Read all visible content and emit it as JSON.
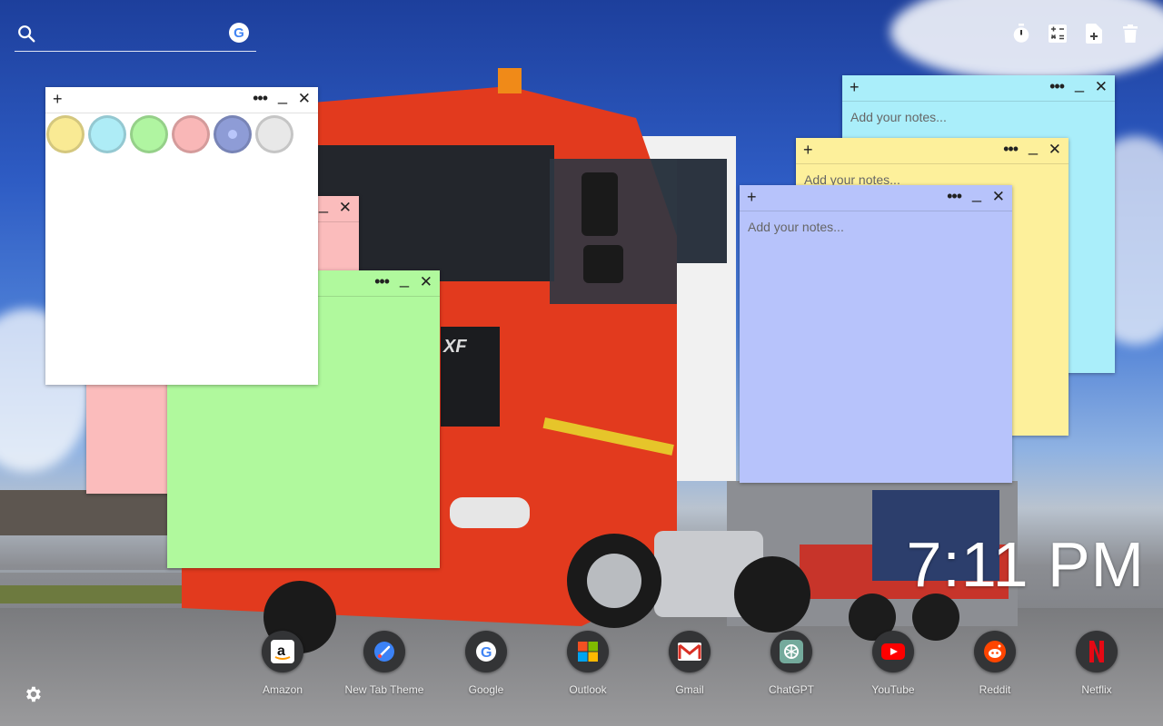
{
  "search": {
    "placeholder": "",
    "engine_icon": "google-icon"
  },
  "toolbar": {
    "icons": [
      "timer-icon",
      "calculator-icon",
      "add-note-icon",
      "trash-icon"
    ]
  },
  "notes": [
    {
      "color": "#aaeefa",
      "placeholder": "Add your notes..."
    },
    {
      "color": "#fdf09b",
      "placeholder": "Add your notes..."
    },
    {
      "color": "#b7c3fb",
      "placeholder": "Add your notes..."
    },
    {
      "color": "#fbbcbc",
      "placeholder": ""
    },
    {
      "color": "#b0f99d",
      "placeholder": ""
    },
    {
      "color": "#ffffff",
      "placeholder": ""
    }
  ],
  "note_buttons": {
    "add": "+",
    "more": "•••",
    "minimize": "_",
    "close": "✕"
  },
  "color_swatches": [
    "#f9ea94",
    "#aeecf6",
    "#b0f5a1",
    "#f9b7b7",
    "#8e9cd6",
    "#e8e8e8"
  ],
  "clock": {
    "time": "7:11 PM"
  },
  "shortcuts": [
    {
      "label": "Amazon",
      "icon": "amazon-icon"
    },
    {
      "label": "New Tab Theme",
      "icon": "new-tab-theme-icon"
    },
    {
      "label": "Google",
      "icon": "google-icon"
    },
    {
      "label": "Outlook",
      "icon": "microsoft-icon"
    },
    {
      "label": "Gmail",
      "icon": "gmail-icon"
    },
    {
      "label": "ChatGPT",
      "icon": "chatgpt-icon"
    },
    {
      "label": "YouTube",
      "icon": "youtube-icon"
    },
    {
      "label": "Reddit",
      "icon": "reddit-icon"
    },
    {
      "label": "Netflix",
      "icon": "netflix-icon"
    }
  ]
}
